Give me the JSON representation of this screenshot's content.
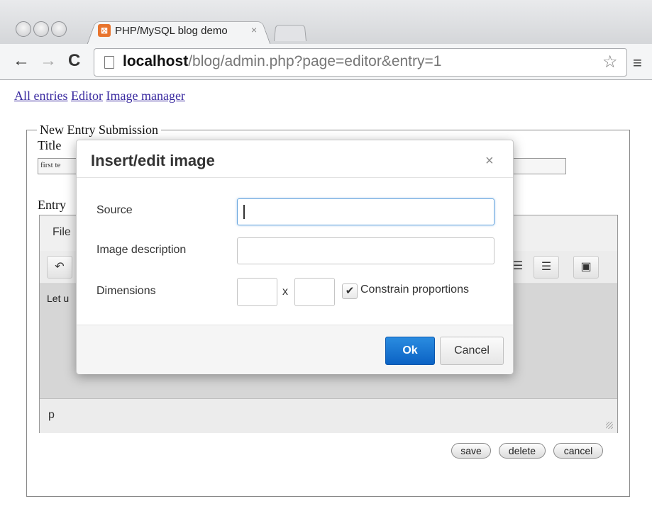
{
  "browser": {
    "tab_title": "PHP/MySQL blog demo",
    "tab_close": "×",
    "url_host": "localhost",
    "url_path": "/blog/admin.php?page=editor&entry=1"
  },
  "nav": {
    "all_entries": "All entries",
    "editor": "Editor",
    "image_manager": "Image manager"
  },
  "form": {
    "legend": "New Entry Submission",
    "title_label": "Title",
    "title_value": "first te",
    "entry_label": "Entry",
    "editor_menu_file": "File",
    "editor_content": "Let u",
    "editor_path": "p",
    "save_label": "save",
    "delete_label": "delete",
    "cancel_label": "cancel"
  },
  "modal": {
    "title": "Insert/edit image",
    "close": "×",
    "source_label": "Source",
    "source_value": "",
    "description_label": "Image description",
    "description_value": "",
    "dimensions_label": "Dimensions",
    "width_value": "",
    "height_value": "",
    "times": "x",
    "constrain_label": "Constrain proportions",
    "constrain_checked": true,
    "ok_label": "Ok",
    "cancel_label": "Cancel"
  },
  "colors": {
    "primary_button": "#0b62c4",
    "link": "#3a2aa0",
    "focus_border": "#68a6de"
  }
}
